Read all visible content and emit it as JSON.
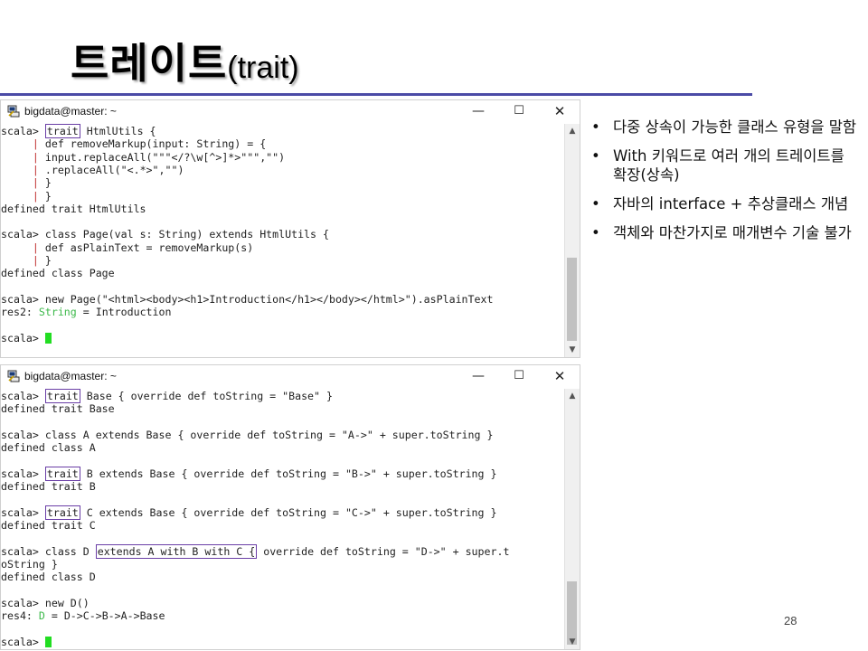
{
  "slide": {
    "title_ko": "트레이트",
    "title_en": "(trait)",
    "page_number": "28"
  },
  "terminal1": {
    "title": "bigdata@master: ~",
    "controls": {
      "minimize": "—",
      "maximize": "☐",
      "close": "✕"
    },
    "lines": [
      {
        "prompt": "scala> ",
        "boxed": "trait",
        "rest": " HtmlUtils {"
      },
      {
        "indent": "     ",
        "pipe": "| ",
        "text": "def removeMarkup(input: String) = {"
      },
      {
        "indent": "     ",
        "pipe": "| ",
        "text": "input.replaceAll(\"\"\"</?\\w[^>]*>\"\"\",\"\")"
      },
      {
        "indent": "     ",
        "pipe": "| ",
        "text": ".replaceAll(\"<.*>\",\"\")"
      },
      {
        "indent": "     ",
        "pipe": "| ",
        "text": "}"
      },
      {
        "indent": "     ",
        "pipe": "| ",
        "text": "}"
      },
      {
        "text": "defined trait HtmlUtils"
      },
      {
        "text": ""
      },
      {
        "prompt": "scala> ",
        "text": "class Page(val s: String) extends HtmlUtils {"
      },
      {
        "indent": "     ",
        "pipe": "| ",
        "text": "def asPlainText = removeMarkup(s)"
      },
      {
        "indent": "     ",
        "pipe": "| ",
        "text": "}"
      },
      {
        "text": "defined class Page"
      },
      {
        "text": ""
      },
      {
        "prompt": "scala> ",
        "text": "new Page(\"<html><body><h1>Introduction</h1></body></html>\").asPlainText"
      },
      {
        "res": "res2",
        "sep": ": ",
        "type": "String",
        "value": " = Introduction"
      },
      {
        "text": ""
      },
      {
        "prompt": "scala> ",
        "cursor": true
      }
    ]
  },
  "terminal2": {
    "title": "bigdata@master: ~",
    "controls": {
      "minimize": "—",
      "maximize": "☐",
      "close": "✕"
    },
    "lines": [
      {
        "prompt": "scala> ",
        "boxed": "trait",
        "rest": " Base { override def toString = \"Base\" }"
      },
      {
        "text": "defined trait Base"
      },
      {
        "text": ""
      },
      {
        "prompt": "scala> ",
        "text": "class A extends Base { override def toString = \"A->\" + super.toString }"
      },
      {
        "text": "defined class A"
      },
      {
        "text": ""
      },
      {
        "prompt": "scala> ",
        "boxed": "trait",
        "rest": " B extends Base { override def toString = \"B->\" + super.toString }"
      },
      {
        "text": "defined trait B"
      },
      {
        "text": ""
      },
      {
        "prompt": "scala> ",
        "boxed": "trait",
        "rest": " C extends Base { override def toString = \"C->\" + super.toString }"
      },
      {
        "text": "defined trait C"
      },
      {
        "text": ""
      },
      {
        "prompt": "scala> ",
        "pre": "class D ",
        "boxed2": "extends A with B with C {",
        "rest": " override def toString = \"D->\" + super.t"
      },
      {
        "text": "oString }"
      },
      {
        "text": "defined class D"
      },
      {
        "text": ""
      },
      {
        "prompt": "scala> ",
        "text": "new D()"
      },
      {
        "res": "res4",
        "sep": ": ",
        "type": "D",
        "value": " = D->C->B->A->Base"
      },
      {
        "text": ""
      },
      {
        "prompt": "scala> ",
        "cursor": true
      }
    ]
  },
  "bullets": [
    "다중 상속이 가능한 클래스 유형을 말함",
    "With 키워드로 여러 개의 트레이트를 확장(상속)",
    "자바의 interface + 추상클래스 개념",
    "객체와 마찬가지로 매개변수 기술 불가"
  ],
  "bullet_symbol": "•",
  "colors": {
    "title_rule": "#4b4ba6",
    "box_highlight": "#6a3ea6",
    "continuation_pipe": "#c03030",
    "type_green": "#3cb94a",
    "cursor": "#22dd22"
  },
  "icons": {
    "terminal_icon": "putty-icon"
  }
}
